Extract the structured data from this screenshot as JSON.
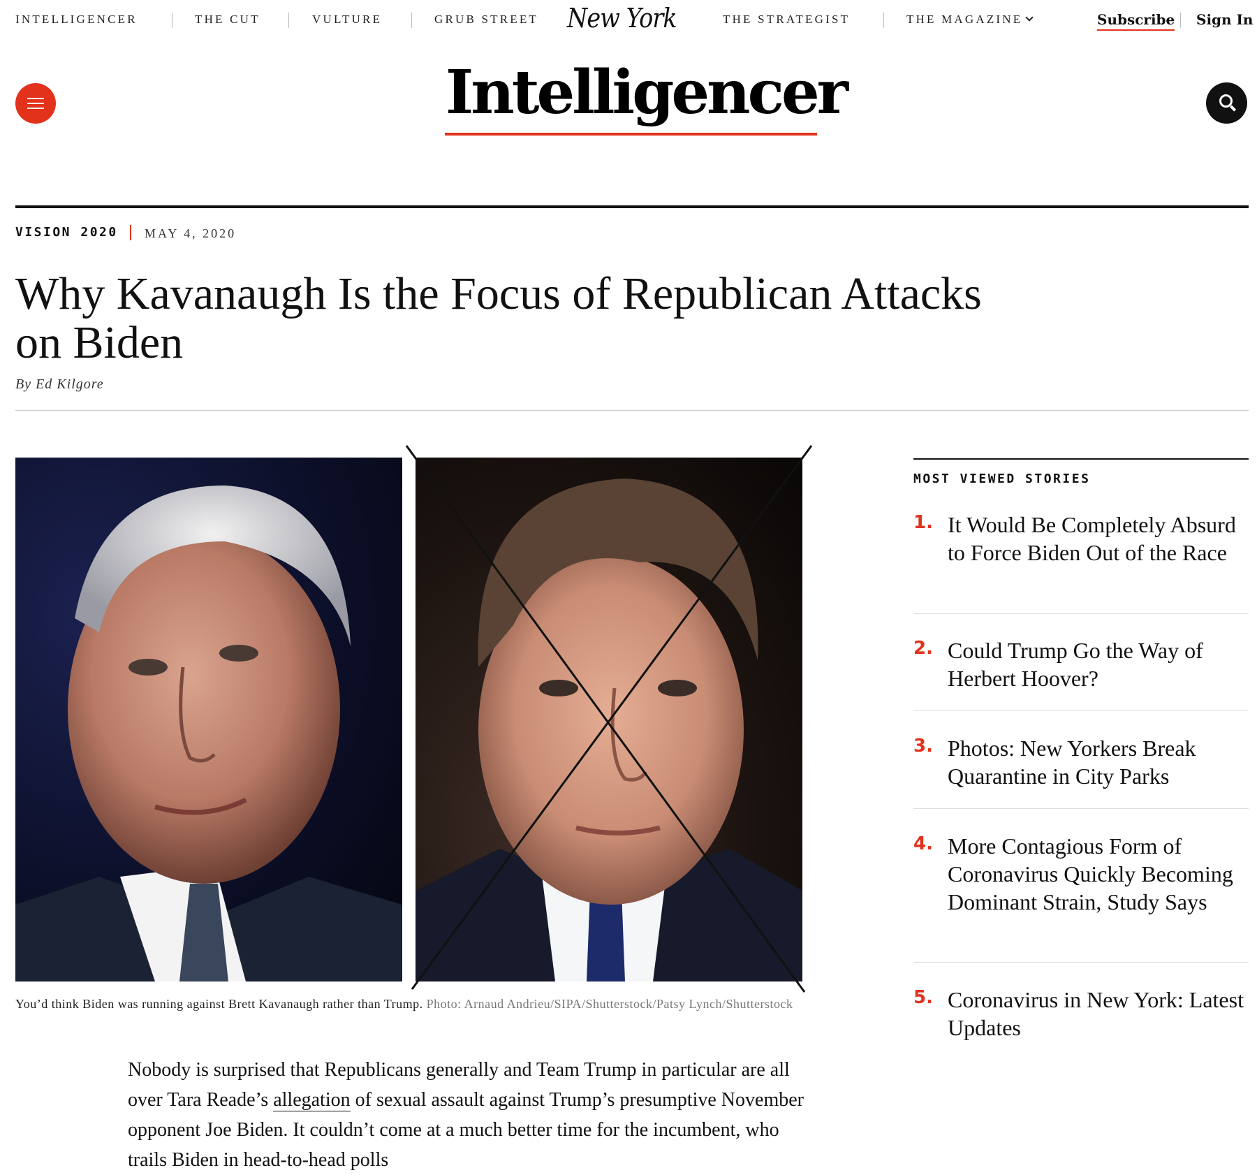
{
  "topnav": {
    "links": [
      "INTELLIGENCER",
      "THE CUT",
      "VULTURE",
      "GRUB STREET",
      "THE STRATEGIST",
      "THE MAGAZINE"
    ],
    "logo": "New York",
    "subscribe": "Subscribe",
    "sign_in": "Sign In"
  },
  "masthead": {
    "title": "Intelligencer",
    "menu_icon": "hamburger-icon",
    "search_icon": "search-icon",
    "accent_color": "#e2321c"
  },
  "article": {
    "rubric": "VISION 2020",
    "date": "MAY 4, 2020",
    "headline": "Why Kavanaugh Is the Focus of Republican Attacks on Biden",
    "byline_prefix": "By",
    "author": "Ed Kilgore",
    "caption": "You’d think Biden was running against Brett Kavanaugh rather than Trump.",
    "credit": "Photo: Arnaud Andrieu/SIPA/Shutterstock/Patsy Lynch/Shutterstock",
    "body_start": "Nobody is surprised that Republicans generally and Team Trump in particular are all over Tara Reade’s",
    "body_link": "allegation",
    "body_rest": "of sexual assault against Trump’s presumptive November opponent Joe Biden. It couldn’t come at a much better time for the incumbent, who trails Biden in head-to-head polls"
  },
  "sidebar": {
    "title": "MOST VIEWED STORIES",
    "items": [
      {
        "num": "1.",
        "title": "It Would Be Completely Absurd to Force Biden Out of the Race"
      },
      {
        "num": "2.",
        "title": "Could Trump Go the Way of Herbert Hoover?"
      },
      {
        "num": "3.",
        "title": "Photos: New Yorkers Break Quarantine in City Parks"
      },
      {
        "num": "4.",
        "title": "More Contagious Form of Coronavirus Quickly Becoming Dominant Strain, Study Says"
      },
      {
        "num": "5.",
        "title": "Coronavirus in New York: Latest Updates"
      }
    ]
  }
}
